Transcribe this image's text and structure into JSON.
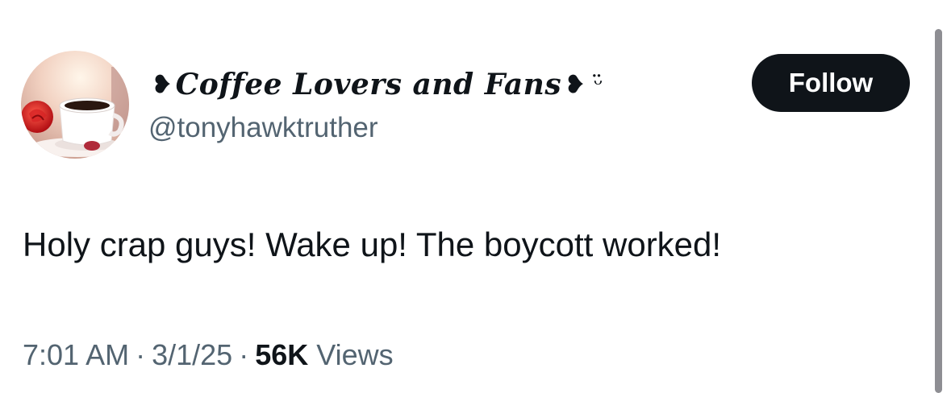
{
  "author": {
    "avatar_icon": "coffee-cup-with-rose-avatar",
    "display_name_prefix_glyph": "❥",
    "display_name": "Coffee Lovers and Fans",
    "display_name_suffix_glyph": "❥",
    "display_name_emoji": "ᵕ̈",
    "handle": "@tonyhawktruther"
  },
  "follow_button": {
    "label": "Follow"
  },
  "tweet": {
    "text": "Holy crap guys! Wake up! The boycott worked!",
    "time": "7:01 AM",
    "separator": "·",
    "date": "3/1/25",
    "views_count": "56K",
    "views_label": "Views"
  },
  "colors": {
    "text_primary": "#0f1419",
    "text_secondary": "#536471",
    "button_bg": "#0f1419",
    "button_text": "#ffffff",
    "scrollbar": "#8e8e93"
  }
}
